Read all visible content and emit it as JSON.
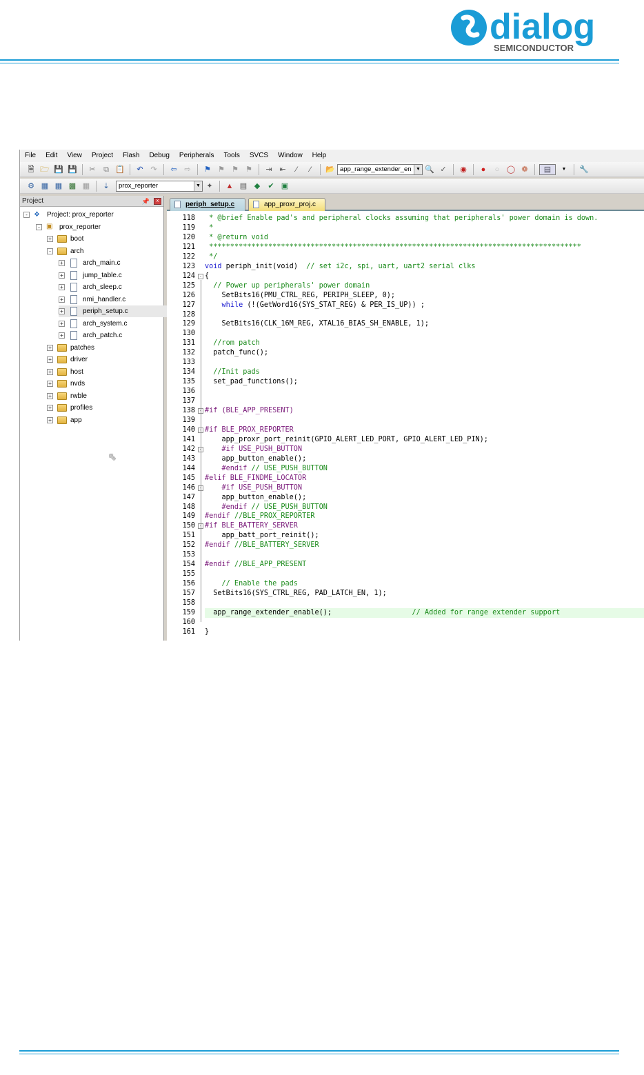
{
  "logo": {
    "brand": "dialog",
    "tagline": "SEMICONDUCTOR"
  },
  "menu": [
    "File",
    "Edit",
    "View",
    "Project",
    "Flash",
    "Debug",
    "Peripherals",
    "Tools",
    "SVCS",
    "Window",
    "Help"
  ],
  "toolbar": {
    "find_combo": "app_range_extender_en",
    "target_combo": "prox_reporter"
  },
  "project_panel": {
    "title": "Project",
    "pin": " ǂ",
    "close": "x",
    "tree": [
      {
        "level": 0,
        "kind": "project",
        "label": "Project: prox_reporter",
        "expander": "-"
      },
      {
        "level": 1,
        "kind": "target",
        "label": "prox_reporter",
        "expander": "-"
      },
      {
        "level": 2,
        "kind": "folder",
        "label": "boot",
        "expander": "+"
      },
      {
        "level": 2,
        "kind": "folder",
        "label": "arch",
        "expander": "-"
      },
      {
        "level": 3,
        "kind": "file",
        "label": "arch_main.c",
        "expander": "+"
      },
      {
        "level": 3,
        "kind": "file",
        "label": "jump_table.c",
        "expander": "+"
      },
      {
        "level": 3,
        "kind": "file",
        "label": "arch_sleep.c",
        "expander": "+"
      },
      {
        "level": 3,
        "kind": "file",
        "label": "nmi_handler.c",
        "expander": "+"
      },
      {
        "level": 3,
        "kind": "file",
        "label": "periph_setup.c",
        "expander": "+",
        "selected": true
      },
      {
        "level": 3,
        "kind": "file",
        "label": "arch_system.c",
        "expander": "+"
      },
      {
        "level": 3,
        "kind": "file",
        "label": "arch_patch.c",
        "expander": "+"
      },
      {
        "level": 2,
        "kind": "folder",
        "label": "patches",
        "expander": "+"
      },
      {
        "level": 2,
        "kind": "folder",
        "label": "driver",
        "expander": "+"
      },
      {
        "level": 2,
        "kind": "folder",
        "label": "host",
        "expander": "+"
      },
      {
        "level": 2,
        "kind": "folder",
        "label": "nvds",
        "expander": "+"
      },
      {
        "level": 2,
        "kind": "folder",
        "label": "rwble",
        "expander": "+"
      },
      {
        "level": 2,
        "kind": "folder",
        "label": "profiles",
        "expander": "+"
      },
      {
        "level": 2,
        "kind": "folder",
        "label": "app",
        "expander": "+"
      }
    ]
  },
  "editor": {
    "tabs": [
      {
        "label": "periph_setup.c",
        "active": true
      },
      {
        "label": "app_proxr_proj.c",
        "active": false
      }
    ],
    "lines": [
      {
        "n": "118",
        "text": " * @brief Enable pad's and peripheral clocks assuming that peripherals' power domain is down.",
        "style": "comment"
      },
      {
        "n": "119",
        "text": " *",
        "style": "comment"
      },
      {
        "n": "120",
        "text": " * @return void",
        "style": "comment"
      },
      {
        "n": "121",
        "text": " ****************************************************************************************",
        "style": "comment"
      },
      {
        "n": "122",
        "text": " */",
        "style": "comment"
      },
      {
        "n": "123",
        "text": "void periph_init(void)  // set i2c, spi, uart, uart2 serial clks",
        "style": "mixed_void"
      },
      {
        "n": "124",
        "text": "{",
        "style": "plain",
        "fold": "-"
      },
      {
        "n": "125",
        "text": "  // Power up peripherals' power domain",
        "style": "comment"
      },
      {
        "n": "126",
        "text": "    SetBits16(PMU_CTRL_REG, PERIPH_SLEEP, 0);",
        "style": "plain"
      },
      {
        "n": "127",
        "text": "    while (!(GetWord16(SYS_STAT_REG) & PER_IS_UP)) ;",
        "style": "mixed_while"
      },
      {
        "n": "128",
        "text": "",
        "style": "plain"
      },
      {
        "n": "129",
        "text": "    SetBits16(CLK_16M_REG, XTAL16_BIAS_SH_ENABLE, 1);",
        "style": "plain"
      },
      {
        "n": "130",
        "text": "",
        "style": "plain"
      },
      {
        "n": "131",
        "text": "  //rom patch",
        "style": "comment"
      },
      {
        "n": "132",
        "text": "  patch_func();",
        "style": "plain"
      },
      {
        "n": "133",
        "text": "",
        "style": "plain"
      },
      {
        "n": "134",
        "text": "  //Init pads",
        "style": "comment"
      },
      {
        "n": "135",
        "text": "  set_pad_functions();",
        "style": "plain"
      },
      {
        "n": "136",
        "text": "",
        "style": "plain"
      },
      {
        "n": "137",
        "text": "",
        "style": "plain"
      },
      {
        "n": "138",
        "text": "#if (BLE_APP_PRESENT)",
        "style": "pp",
        "fold": "-"
      },
      {
        "n": "139",
        "text": "",
        "style": "plain"
      },
      {
        "n": "140",
        "text": "#if BLE_PROX_REPORTER",
        "style": "pp",
        "fold": "-"
      },
      {
        "n": "141",
        "text": "    app_proxr_port_reinit(GPIO_ALERT_LED_PORT, GPIO_ALERT_LED_PIN);",
        "style": "plain"
      },
      {
        "n": "142",
        "text": "    #if USE_PUSH_BUTTON",
        "style": "pp",
        "fold": "-"
      },
      {
        "n": "143",
        "text": "    app_button_enable();",
        "style": "plain"
      },
      {
        "n": "144",
        "text": "    #endif // USE_PUSH_BUTTON",
        "style": "pp_comment"
      },
      {
        "n": "145",
        "text": "#elif BLE_FINDME_LOCATOR",
        "style": "pp"
      },
      {
        "n": "146",
        "text": "    #if USE_PUSH_BUTTON",
        "style": "pp",
        "fold": "-"
      },
      {
        "n": "147",
        "text": "    app_button_enable();",
        "style": "plain"
      },
      {
        "n": "148",
        "text": "    #endif // USE_PUSH_BUTTON",
        "style": "pp_comment"
      },
      {
        "n": "149",
        "text": "#endif //BLE_PROX_REPORTER",
        "style": "pp_comment"
      },
      {
        "n": "150",
        "text": "#if BLE_BATTERY_SERVER",
        "style": "pp",
        "fold": "-"
      },
      {
        "n": "151",
        "text": "    app_batt_port_reinit();",
        "style": "plain"
      },
      {
        "n": "152",
        "text": "#endif //BLE_BATTERY_SERVER",
        "style": "pp_comment"
      },
      {
        "n": "153",
        "text": "",
        "style": "plain"
      },
      {
        "n": "154",
        "text": "#endif //BLE_APP_PRESENT",
        "style": "pp_comment"
      },
      {
        "n": "155",
        "text": "",
        "style": "plain"
      },
      {
        "n": "156",
        "text": "    // Enable the pads",
        "style": "comment"
      },
      {
        "n": "157",
        "text": "  SetBits16(SYS_CTRL_REG, PAD_LATCH_EN, 1);",
        "style": "plain"
      },
      {
        "n": "158",
        "text": "",
        "style": "plain"
      },
      {
        "n": "159",
        "text": "  app_range_extender_enable();                   // Added for range extender support",
        "style": "highlight"
      },
      {
        "n": "160",
        "text": "",
        "style": "plain"
      },
      {
        "n": "161",
        "text": "}",
        "style": "plain"
      }
    ]
  },
  "colors": {
    "accent": "#1a9cd6",
    "comment": "#1a8a1a",
    "keyword": "#1a1ad0",
    "highlight": "#e6fbe6"
  }
}
